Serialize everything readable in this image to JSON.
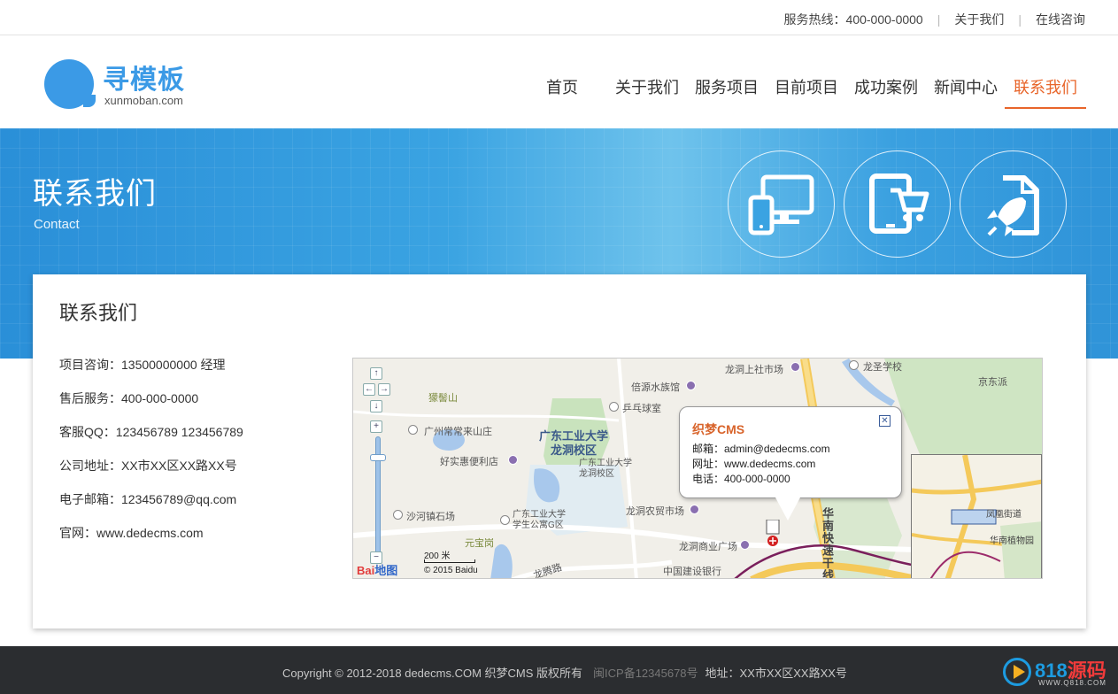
{
  "topbar": {
    "hotline": "服务热线：400-000-0000",
    "about": "关于我们",
    "consult": "在线咨询"
  },
  "logo": {
    "brand": "寻模板",
    "domain": "xunmoban.com"
  },
  "nav": {
    "items": [
      "首页",
      "关于我们",
      "服务项目",
      "目前项目",
      "成功案例",
      "新闻中心",
      "联系我们"
    ],
    "active": "联系我们"
  },
  "banner": {
    "title": "联系我们",
    "subtitle": "Contact",
    "icons": [
      "devices-icon",
      "tablet-cart-icon",
      "rocket-document-icon"
    ]
  },
  "panel": {
    "heading": "联系我们",
    "info": [
      "项目咨询：13500000000  经理",
      "售后服务：400-000-0000",
      "客服QQ：123456789  123456789",
      "公司地址：XX市XX区XX路XX号",
      "电子邮箱：123456789@qq.com",
      "官网：www.dedecms.com"
    ]
  },
  "map": {
    "popup": {
      "title": "织梦CMS",
      "email": "邮箱：admin@dedecms.com",
      "site": "网址：www.dedecms.com",
      "phone": "电话：400-000-0000"
    },
    "labels": {
      "l1": "龙洞上社市场",
      "l2": "龙圣学校",
      "l3": "京东派",
      "l4": "倍源水族馆",
      "l5": "獴髻山",
      "l6": "乒乓球室",
      "l7": "广州常常来山庄",
      "l8": "广东工业大学\n龙洞校区",
      "l9": "广东工业大学\n龙洞校区",
      "l10": "好实惠便利店",
      "l11": "沙河镇石场",
      "l12": "广东工业大学\n学生公寓G区",
      "l13": "龙洞农贸市场",
      "l14": "元宝岗",
      "l15": "龙洞商业广场",
      "l16": "中国建设银行",
      "l17": "龙腾路",
      "l18": "华南快速干线",
      "l19": "凤凰街道",
      "l20": "华南植物园"
    },
    "scale": "200 米",
    "copyright": "© 2015 Baidu",
    "baidu_logo_a": "Bai",
    "baidu_logo_b": "地图"
  },
  "footer": {
    "copyright": "Copyright © 2012-2018 dedecms.COM 织梦CMS 版权所有",
    "icp": "闽ICP备12345678号",
    "address": "地址：XX市XX区XX路XX号"
  },
  "watermark": {
    "num": "818",
    "cn": "源码",
    "site": "WWW.Q818.COM"
  },
  "colors": {
    "accent": "#e8652a",
    "brand": "#3b9ae6",
    "banner": "#3aa3e2",
    "footer": "#2b2d30"
  }
}
